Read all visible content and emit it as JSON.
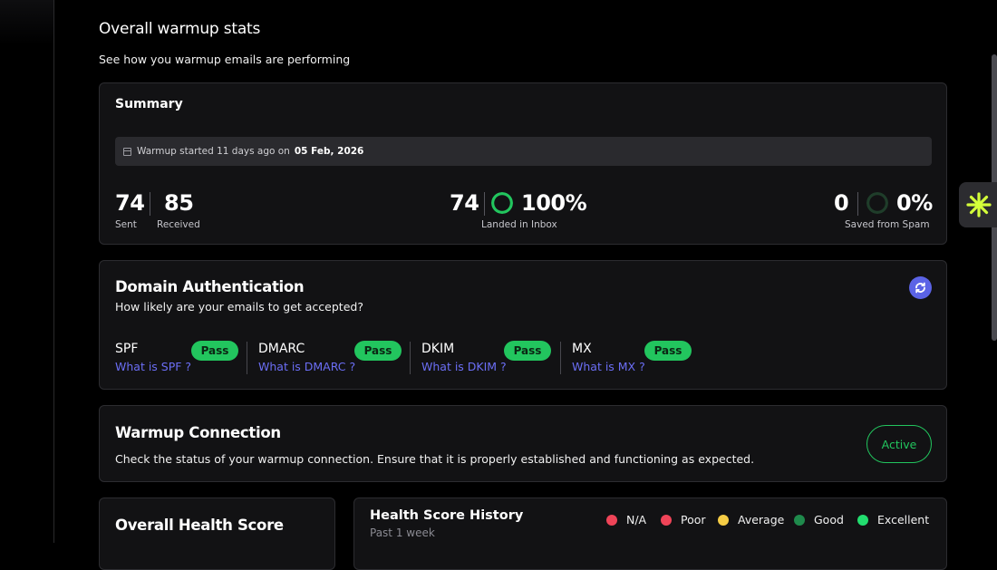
{
  "page": {
    "title": "Overall warmup stats",
    "subtitle": "See how you warmup emails are performing"
  },
  "summary": {
    "title": "Summary",
    "warmup_started_text": "Warmup started 11 days ago on",
    "warmup_started_date": "05 Feb, 2026",
    "sent_value": "74",
    "sent_label": "Sent",
    "received_value": "85",
    "received_label": "Received",
    "inbox_count": "74",
    "inbox_percent": "100%",
    "inbox_label": "Landed in Inbox",
    "inbox_ratio": 1.0,
    "spam_count": "0",
    "spam_percent": "0%",
    "spam_label": "Saved from Spam",
    "spam_ratio": 0.0
  },
  "domain_auth": {
    "title": "Domain Authentication",
    "subtitle": "How likely are your emails to get accepted?",
    "refresh_icon": "refresh-icon",
    "records": [
      {
        "name": "SPF",
        "status": "Pass",
        "link": "What is SPF ?"
      },
      {
        "name": "DMARC",
        "status": "Pass",
        "link": "What is DMARC ?"
      },
      {
        "name": "DKIM",
        "status": "Pass",
        "link": "What is DKIM ?"
      },
      {
        "name": "MX",
        "status": "Pass",
        "link": "What is MX ?"
      }
    ]
  },
  "connection": {
    "title": "Warmup Connection",
    "description": "Check the status of your warmup connection. Ensure that it is properly established and functioning as expected.",
    "status": "Active"
  },
  "health": {
    "title": "Overall Health Score"
  },
  "history": {
    "title": "Health Score History",
    "subtitle": "Past 1 week",
    "legend": [
      {
        "label": "N/A",
        "color": "#ef4458"
      },
      {
        "label": "Poor",
        "color": "#ef4458"
      },
      {
        "label": "Average",
        "color": "#f5cc45"
      },
      {
        "label": "Good",
        "color": "#1f8a4c"
      },
      {
        "label": "Excellent",
        "color": "#22dd6f"
      }
    ]
  },
  "colors": {
    "accent_green": "#22c55e",
    "link_blue": "#6b6ef5",
    "refresh_bg": "#5b63e6",
    "widget_icon": "#d4ff3a"
  }
}
